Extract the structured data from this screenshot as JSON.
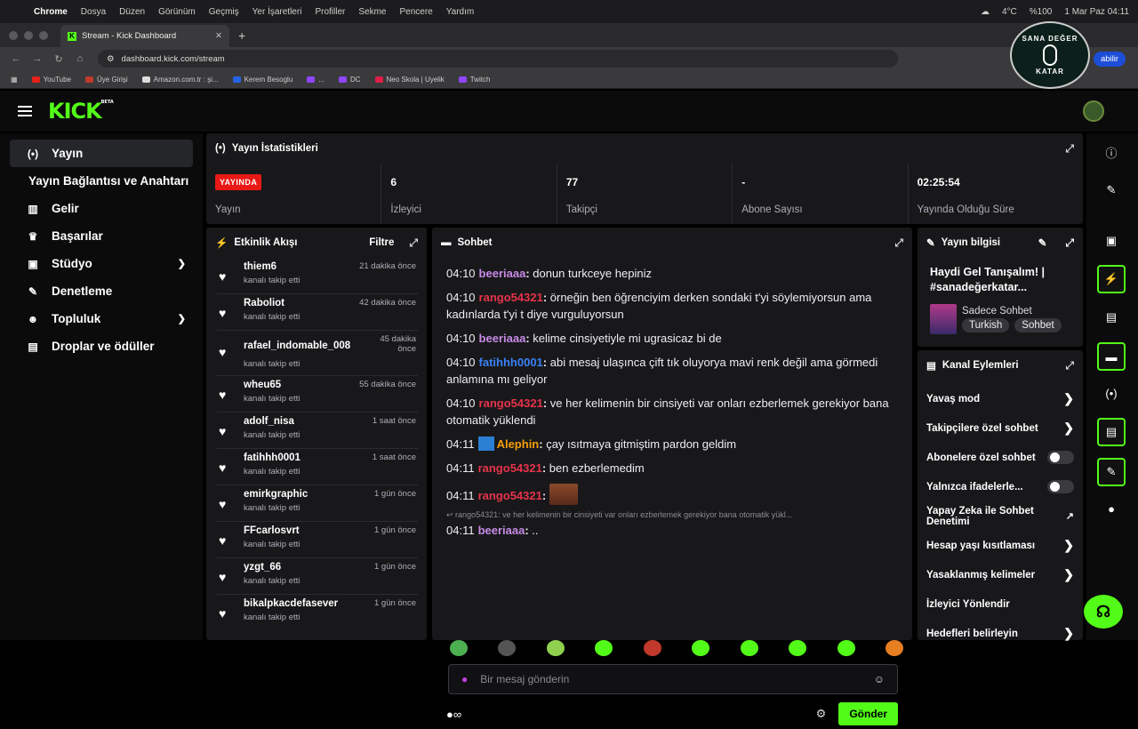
{
  "macos": {
    "menu": [
      "Chrome",
      "Dosya",
      "Düzen",
      "Görünüm",
      "Geçmiş",
      "Yer İşaretleri",
      "Profiller",
      "Sekme",
      "Pencere",
      "Yardım"
    ],
    "temp": "4°C",
    "battery": "%100",
    "datetime": "1 Mar Paz  04:11"
  },
  "browser": {
    "tab_title": "Stream - Kick Dashboard",
    "url": "dashboard.kick.com/stream",
    "update_label": "abilir",
    "bookmarks": [
      "YouTube",
      "Üye Girişi",
      "Amazon.com.tr : şi...",
      "Kerem Besoglu",
      "...",
      "DC",
      "Neo Skola | Uyelik",
      "Twitch"
    ]
  },
  "overlay": {
    "top": "SANA DEĞER",
    "bottom": "KATAR"
  },
  "logo": {
    "text": "KICK",
    "beta": "BETA"
  },
  "sidebar": {
    "items": [
      {
        "label": "Yayın",
        "icon": "broadcast-icon"
      },
      {
        "label": "Yayın Bağlantısı ve Anahtarı",
        "icon": ""
      },
      {
        "label": "Gelir",
        "icon": "chart-icon"
      },
      {
        "label": "Başarılar",
        "icon": "trophy-icon"
      },
      {
        "label": "Stüdyo",
        "icon": "studio-icon"
      },
      {
        "label": "Denetleme",
        "icon": "wrench-icon"
      },
      {
        "label": "Topluluk",
        "icon": "people-icon"
      },
      {
        "label": "Droplar ve ödüller",
        "icon": "drops-icon"
      }
    ]
  },
  "stats": {
    "title": "Yayın İstatistikleri",
    "badge": "YAYINDA",
    "items": [
      {
        "value": "",
        "label": "Yayın"
      },
      {
        "value": "6",
        "label": "İzleyici"
      },
      {
        "value": "77",
        "label": "Takipçi"
      },
      {
        "value": "-",
        "label": "Abone Sayısı"
      },
      {
        "value": "02:25:54",
        "label": "Yayında Olduğu Süre"
      }
    ]
  },
  "activity": {
    "title": "Etkinlik Akışı",
    "filter": "Filtre",
    "items": [
      {
        "name": "thiem6",
        "sub": "kanalı takip etti",
        "time": "21 dakika önce"
      },
      {
        "name": "Raboliot",
        "sub": "kanalı takip etti",
        "time": "42 dakika önce"
      },
      {
        "name": "rafael_indomable_008",
        "sub": "kanalı takip etti",
        "time": "45 dakika önce"
      },
      {
        "name": "wheu65",
        "sub": "kanalı takip etti",
        "time": "55 dakika önce"
      },
      {
        "name": "adolf_nisa",
        "sub": "kanalı takip etti",
        "time": "1 saat önce"
      },
      {
        "name": "fatihhh0001",
        "sub": "kanalı takip etti",
        "time": "1 saat önce"
      },
      {
        "name": "emirkgraphic",
        "sub": "kanalı takip etti",
        "time": "1 gün önce"
      },
      {
        "name": "FFcarlosvrt",
        "sub": "kanalı takip etti",
        "time": "1 gün önce"
      },
      {
        "name": "yzgt_66",
        "sub": "kanalı takip etti",
        "time": "1 gün önce"
      },
      {
        "name": "bikalpkacdefasever",
        "sub": "kanalı takip etti",
        "time": "1 gün önce"
      }
    ]
  },
  "chat": {
    "title": "Sohbet",
    "messages": [
      {
        "time": "04:10",
        "user": "beeriaaa",
        "color": "#c88ae6",
        "text": "donun turkceye hepiniz"
      },
      {
        "time": "04:10",
        "user": "rango54321",
        "color": "#e8334a",
        "text": "örneğin ben öğrenciyim derken sondaki t'yi söylemiyorsun ama kadınlarda t'yi t diye vurguluyorsun"
      },
      {
        "time": "04:10",
        "user": "beeriaaa",
        "color": "#c88ae6",
        "text": "kelime cinsiyetiyle mi ugrasicaz bi de"
      },
      {
        "time": "04:10",
        "user": "fatihhh0001",
        "color": "#3b82f6",
        "text": "abi mesaj ulaşınca çift tık oluyorya mavi renk değil ama görmedi anlamına mı geliyor"
      },
      {
        "time": "04:10",
        "user": "rango54321",
        "color": "#e8334a",
        "text": "ve her kelimenin bir cinsiyeti var onları ezberlemek gerekiyor bana otomatik yüklendi"
      },
      {
        "time": "04:11",
        "user": "Alephin",
        "color": "#f59e0b",
        "text": "çay ısıtmaya gitmiştim pardon geldim"
      },
      {
        "time": "04:11",
        "user": "rango54321",
        "color": "#e8334a",
        "text": "ben ezberlemedim"
      },
      {
        "time": "04:11",
        "user": "rango54321",
        "color": "#e8334a",
        "text": ""
      }
    ],
    "reply": "rango54321: ve her kelimenin bir cinsiyeti var onları ezberlemek gerekiyor bana otomatik yükl...",
    "last": {
      "time": "04:11",
      "user": "beeriaaa",
      "color": "#c88ae6",
      "text": ".."
    },
    "placeholder": "Bir mesaj gönderin",
    "send": "Gönder"
  },
  "info": {
    "title": "Yayın bilgisi",
    "stream_title": "Haydi Gel Tanışalım! | #sanadeğerkatar...",
    "category": "Sadece Sohbet",
    "tags": [
      "Turkish",
      "Sohbet"
    ]
  },
  "actions": {
    "title": "Kanal Eylemleri",
    "items": [
      {
        "label": "Yavaş mod",
        "kind": "chevron"
      },
      {
        "label": "Takipçilere özel sohbet",
        "kind": "chevron"
      },
      {
        "label": "Abonelere özel sohbet",
        "kind": "toggle"
      },
      {
        "label": "Yalnızca ifadelerle...",
        "kind": "toggle"
      },
      {
        "label": "Yapay Zeka ile Sohbet Denetimi",
        "kind": "external"
      },
      {
        "label": "Hesap yaşı kısıtlaması",
        "kind": "chevron"
      },
      {
        "label": "Yasaklanmış kelimeler",
        "kind": "chevron"
      },
      {
        "label": "İzleyici Yönlendir",
        "kind": "none"
      },
      {
        "label": "Hedefleri belirleyin",
        "kind": "chevron"
      }
    ]
  },
  "colors": {
    "accent": "#53fc18",
    "live": "#e91916",
    "panel": "#18181b"
  }
}
